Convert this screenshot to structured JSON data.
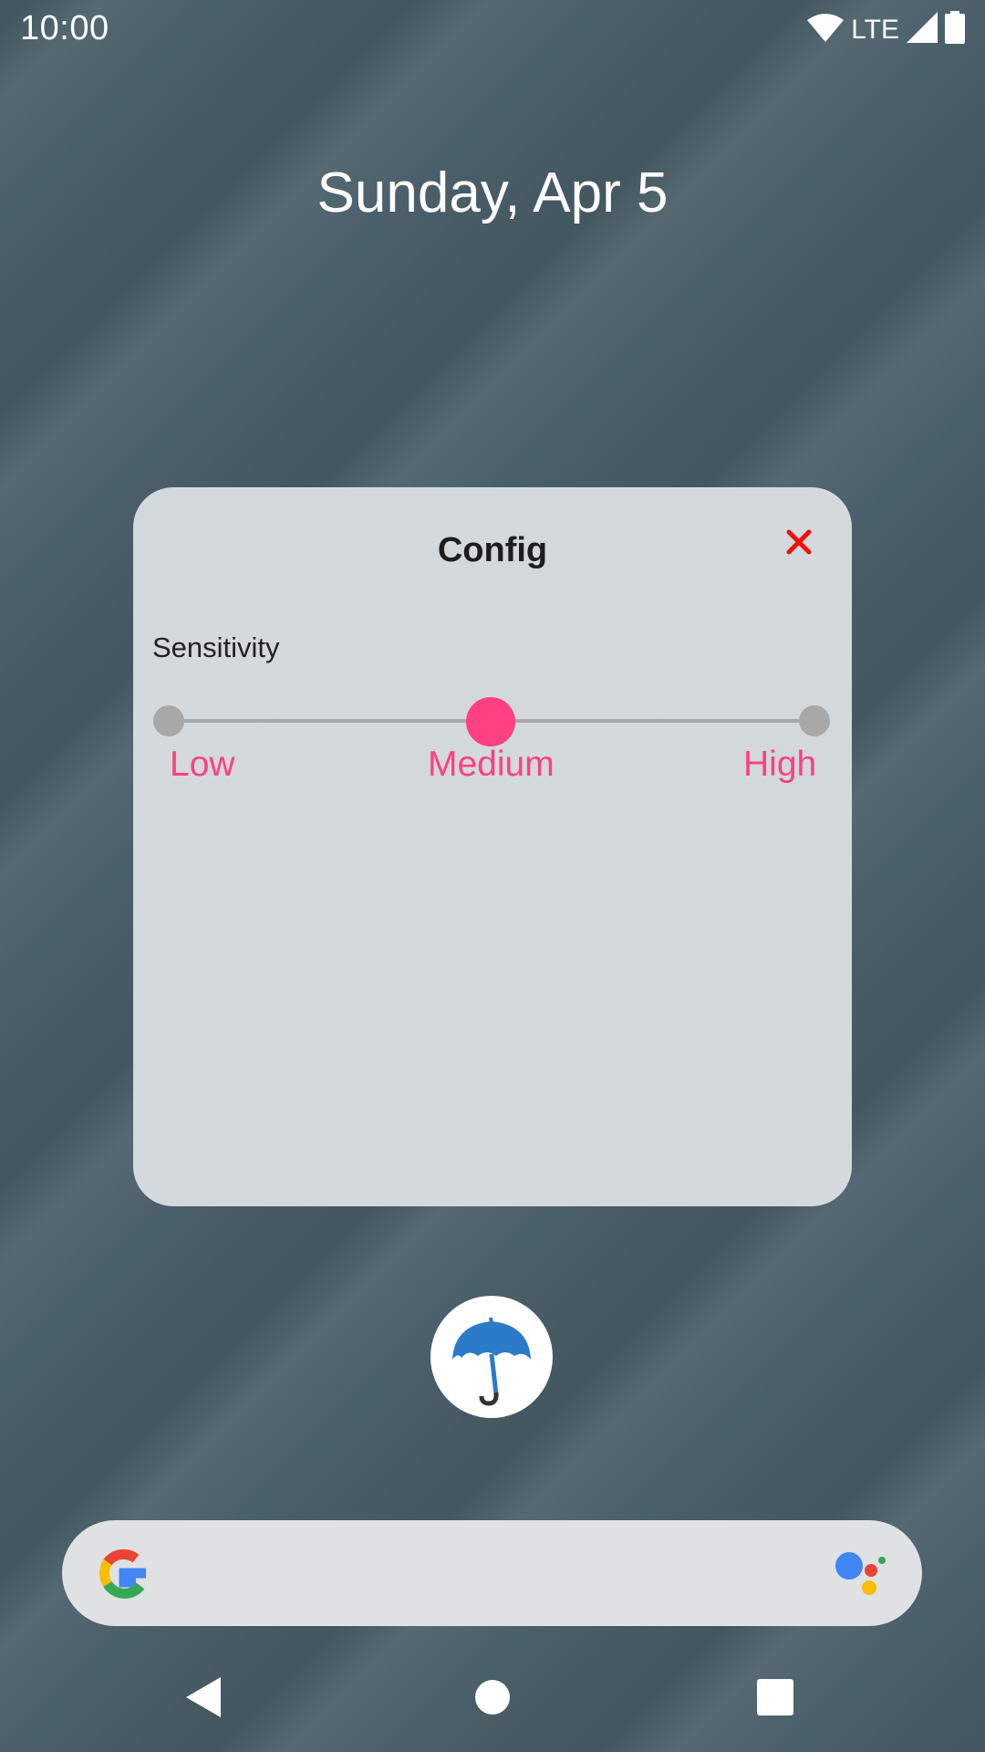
{
  "status_bar": {
    "time": "10:00",
    "network": "LTE",
    "icons": [
      "wifi-icon",
      "signal-icon",
      "battery-icon"
    ]
  },
  "home": {
    "date": "Sunday, Apr 5"
  },
  "config_dialog": {
    "title": "Config",
    "close_icon": "close-icon",
    "sensitivity": {
      "label": "Sensitivity",
      "options": [
        "Low",
        "Medium",
        "High"
      ],
      "selected": "Medium"
    }
  },
  "app_icon": {
    "icon": "umbrella-icon"
  },
  "search_bar": {
    "logo": "google-logo",
    "assistant_icon": "assistant-icon"
  },
  "nav_bar": {
    "buttons": [
      "back-icon",
      "home-icon",
      "recents-icon"
    ]
  },
  "colors": {
    "accent": "#ff4081",
    "close": "#ee1111",
    "track": "#a8a8a8",
    "umbrella": "#2c7bc9"
  }
}
